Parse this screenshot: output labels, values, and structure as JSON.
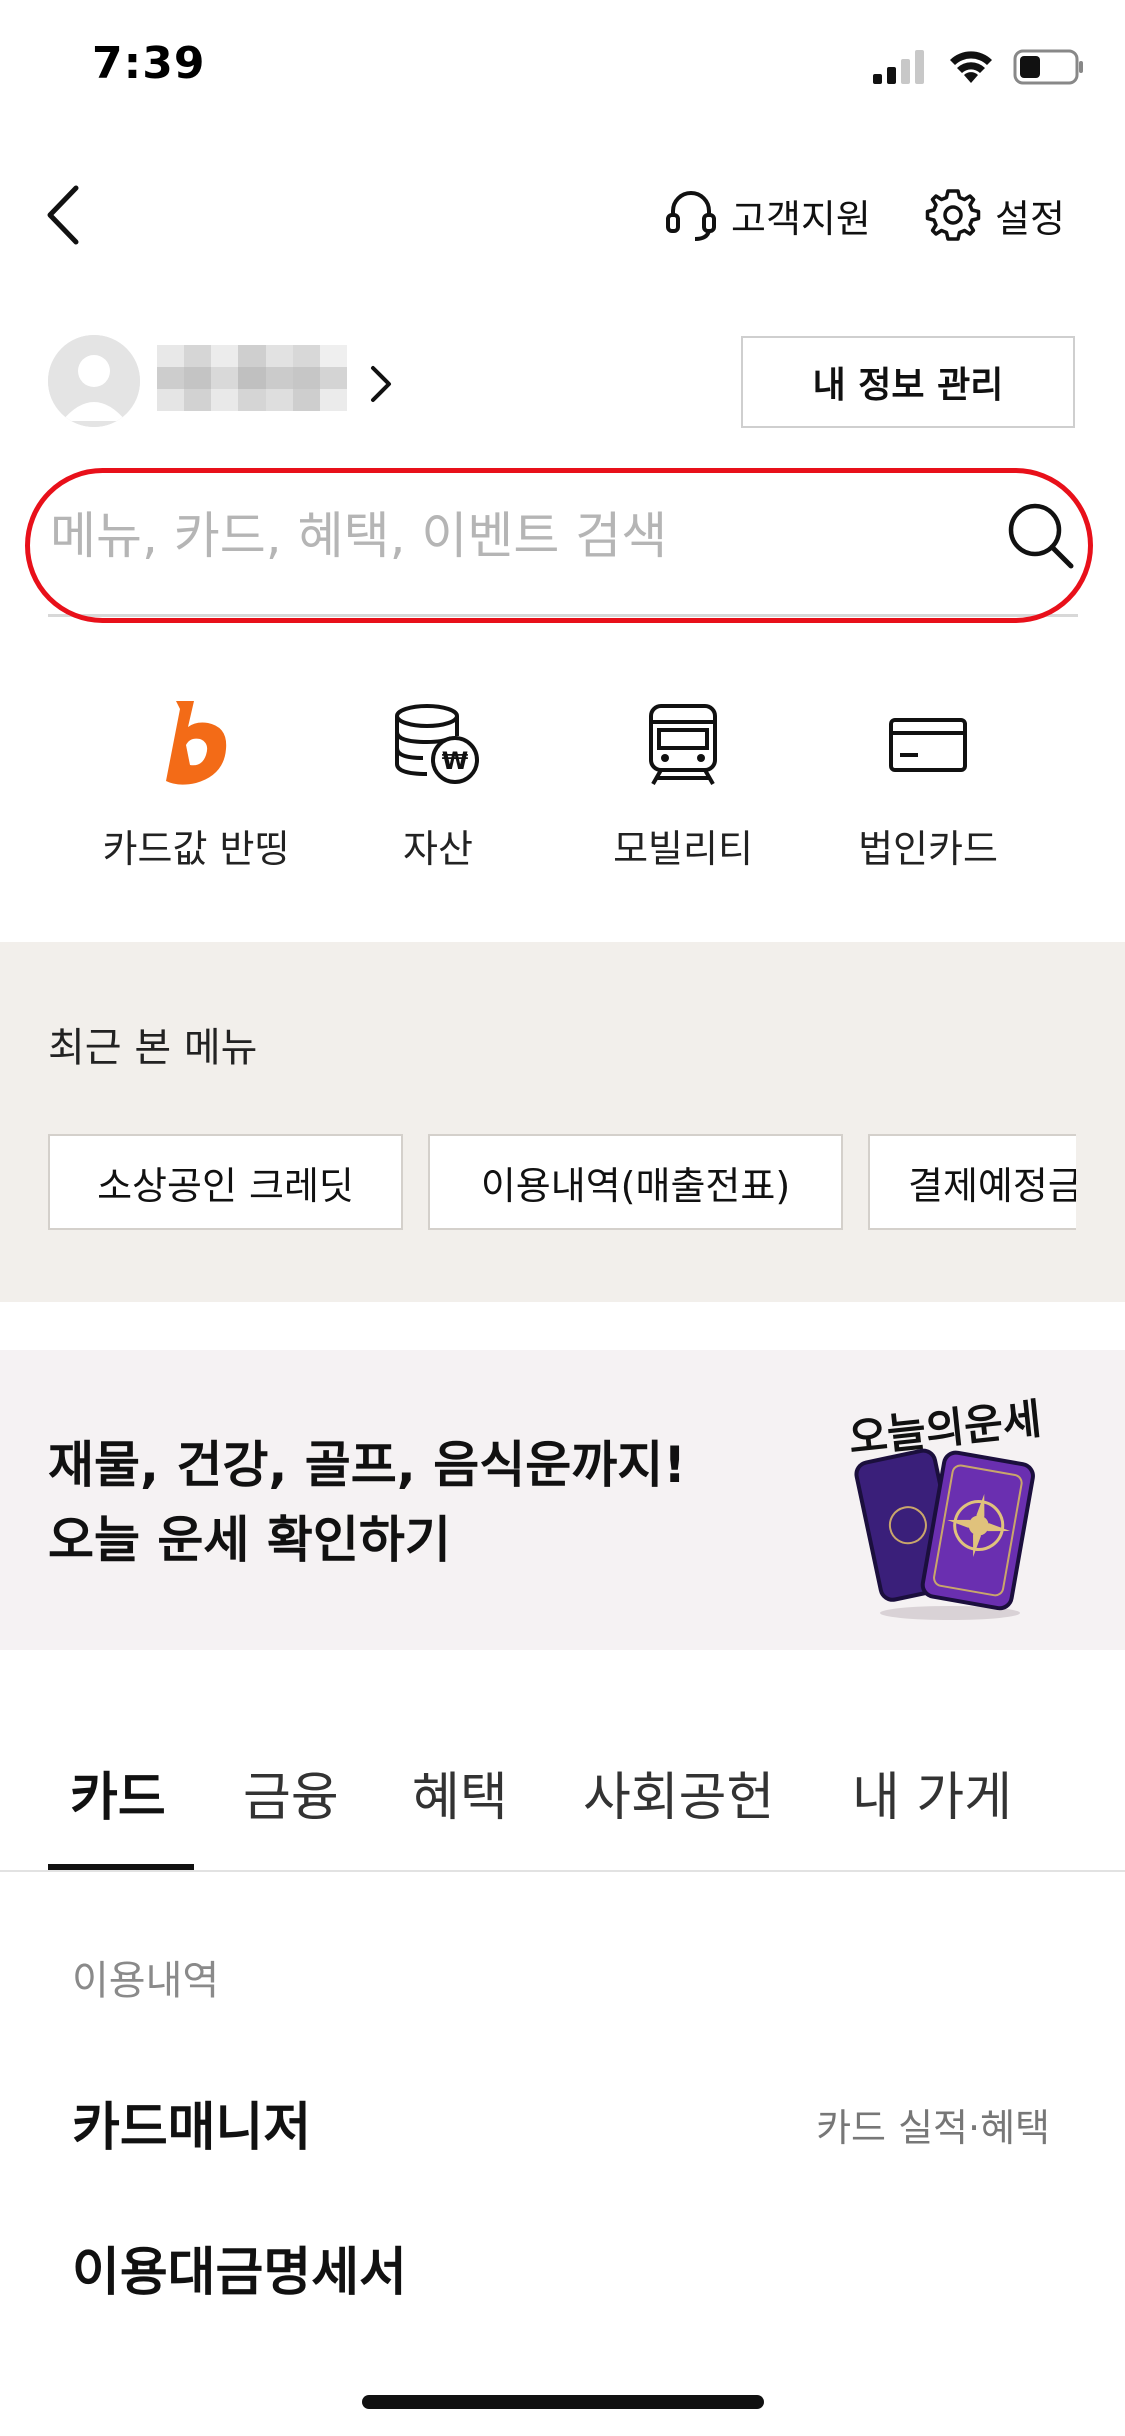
{
  "status_bar": {
    "time": "7:39"
  },
  "header": {
    "support_label": "고객지원",
    "settings_label": "설정"
  },
  "profile": {
    "my_info_button": "내 정보 관리"
  },
  "search": {
    "placeholder": "메뉴, 카드, 혜택, 이벤트 검색",
    "highlight_color": "#e8101a"
  },
  "quick_menu": [
    {
      "label": "카드값 반띵",
      "icon": "b-logo-icon"
    },
    {
      "label": "자산",
      "icon": "coins-won-icon"
    },
    {
      "label": "모빌리티",
      "icon": "train-icon"
    },
    {
      "label": "법인카드",
      "icon": "credit-card-icon"
    }
  ],
  "recent": {
    "title": "최근 본 메뉴",
    "chips": [
      "소상공인 크레딧",
      "이용내역(매출전표)",
      "결제예정금액"
    ]
  },
  "banner": {
    "line1": "재물, 건강, 골프, 음식운까지!",
    "line2": "오늘 운세 확인하기",
    "image_title": "오늘의운세"
  },
  "tabs": [
    "카드",
    "금융",
    "혜택",
    "사회공헌",
    "내 가게"
  ],
  "list": {
    "section_label": "이용내역",
    "items": [
      {
        "title": "카드매니저",
        "sub": "카드 실적·혜택"
      },
      {
        "title": "이용대금명세서",
        "sub": ""
      }
    ]
  },
  "colors": {
    "brand_orange": "#f36b17",
    "recent_bg": "#f2efeb",
    "banner_bg": "#f5f2f3"
  }
}
